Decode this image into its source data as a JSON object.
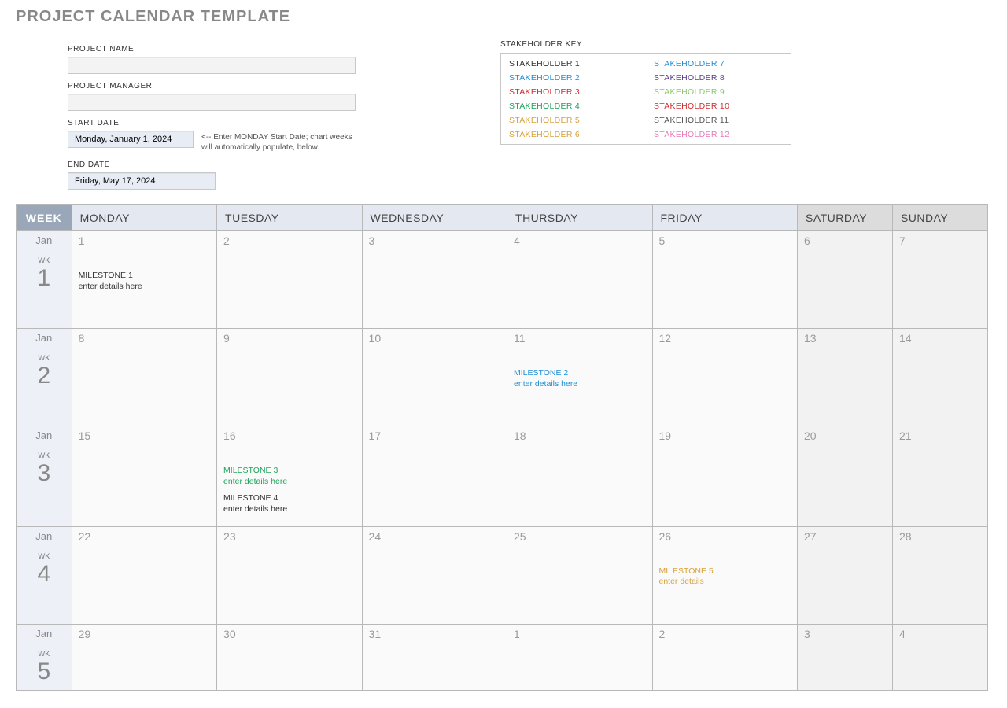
{
  "title": "PROJECT CALENDAR TEMPLATE",
  "labels": {
    "project_name": "PROJECT NAME",
    "project_manager": "PROJECT MANAGER",
    "start_date": "START DATE",
    "end_date": "END DATE",
    "stakeholder_key": "STAKEHOLDER KEY",
    "hint": "<-- Enter MONDAY Start Date; chart weeks will automatically populate, below.",
    "week_h": "WEEK",
    "wk_abbrev": "wk"
  },
  "inputs": {
    "project_name": "",
    "project_manager": "",
    "start_date": "Monday, January 1, 2024",
    "end_date": "Friday, May 17, 2024"
  },
  "stakeholders": [
    {
      "label": "STAKEHOLDER 1",
      "color": "#333333"
    },
    {
      "label": "STAKEHOLDER 7",
      "color": "#1f8fd6"
    },
    {
      "label": "STAKEHOLDER 2",
      "color": "#1f8fd6"
    },
    {
      "label": "STAKEHOLDER 8",
      "color": "#5a3d8a"
    },
    {
      "label": "STAKEHOLDER 3",
      "color": "#d22d2d"
    },
    {
      "label": "STAKEHOLDER 9",
      "color": "#8cc96a"
    },
    {
      "label": "STAKEHOLDER 4",
      "color": "#1fa35a"
    },
    {
      "label": "STAKEHOLDER 10",
      "color": "#d22d2d"
    },
    {
      "label": "STAKEHOLDER 5",
      "color": "#d8a23c"
    },
    {
      "label": "STAKEHOLDER 11",
      "color": "#555555"
    },
    {
      "label": "STAKEHOLDER 6",
      "color": "#d8a23c"
    },
    {
      "label": "STAKEHOLDER 12",
      "color": "#e67ab8"
    }
  ],
  "day_headers": [
    "MONDAY",
    "TUESDAY",
    "WEDNESDAY",
    "THURSDAY",
    "FRIDAY",
    "SATURDAY",
    "SUNDAY"
  ],
  "weeks": [
    {
      "month": "Jan",
      "num": "1",
      "days": [
        {
          "d": "1",
          "we": false,
          "ms": [
            {
              "t": "MILESTONE 1",
              "s": "enter details here",
              "c": "#333333"
            }
          ]
        },
        {
          "d": "2",
          "we": false,
          "ms": []
        },
        {
          "d": "3",
          "we": false,
          "ms": []
        },
        {
          "d": "4",
          "we": false,
          "ms": []
        },
        {
          "d": "5",
          "we": false,
          "ms": []
        },
        {
          "d": "6",
          "we": true,
          "ms": []
        },
        {
          "d": "7",
          "we": true,
          "ms": []
        }
      ]
    },
    {
      "month": "Jan",
      "num": "2",
      "days": [
        {
          "d": "8",
          "we": false,
          "ms": []
        },
        {
          "d": "9",
          "we": false,
          "ms": []
        },
        {
          "d": "10",
          "we": false,
          "ms": []
        },
        {
          "d": "11",
          "we": false,
          "ms": [
            {
              "t": "MILESTONE 2",
              "s": "enter details here",
              "c": "#1f8fd6"
            }
          ]
        },
        {
          "d": "12",
          "we": false,
          "ms": []
        },
        {
          "d": "13",
          "we": true,
          "ms": []
        },
        {
          "d": "14",
          "we": true,
          "ms": []
        }
      ]
    },
    {
      "month": "Jan",
      "num": "3",
      "days": [
        {
          "d": "15",
          "we": false,
          "ms": []
        },
        {
          "d": "16",
          "we": false,
          "ms": [
            {
              "t": "MILESTONE 3",
              "s": "enter details here",
              "c": "#1fa35a"
            },
            {
              "t": "MILESTONE 4",
              "s": "enter details here",
              "c": "#333333"
            }
          ]
        },
        {
          "d": "17",
          "we": false,
          "ms": []
        },
        {
          "d": "18",
          "we": false,
          "ms": []
        },
        {
          "d": "19",
          "we": false,
          "ms": []
        },
        {
          "d": "20",
          "we": true,
          "ms": []
        },
        {
          "d": "21",
          "we": true,
          "ms": []
        }
      ]
    },
    {
      "month": "Jan",
      "num": "4",
      "days": [
        {
          "d": "22",
          "we": false,
          "ms": []
        },
        {
          "d": "23",
          "we": false,
          "ms": []
        },
        {
          "d": "24",
          "we": false,
          "ms": []
        },
        {
          "d": "25",
          "we": false,
          "ms": []
        },
        {
          "d": "26",
          "we": false,
          "ms": [
            {
              "t": "MILESTONE 5",
              "s": "enter details",
              "c": "#d8a23c"
            }
          ]
        },
        {
          "d": "27",
          "we": true,
          "ms": []
        },
        {
          "d": "28",
          "we": true,
          "ms": []
        }
      ]
    },
    {
      "month": "Jan",
      "num": "5",
      "days": [
        {
          "d": "29",
          "we": false,
          "ms": []
        },
        {
          "d": "30",
          "we": false,
          "ms": []
        },
        {
          "d": "31",
          "we": false,
          "ms": []
        },
        {
          "d": "1",
          "we": false,
          "ms": []
        },
        {
          "d": "2",
          "we": false,
          "ms": []
        },
        {
          "d": "3",
          "we": true,
          "ms": []
        },
        {
          "d": "4",
          "we": true,
          "ms": []
        }
      ]
    }
  ]
}
